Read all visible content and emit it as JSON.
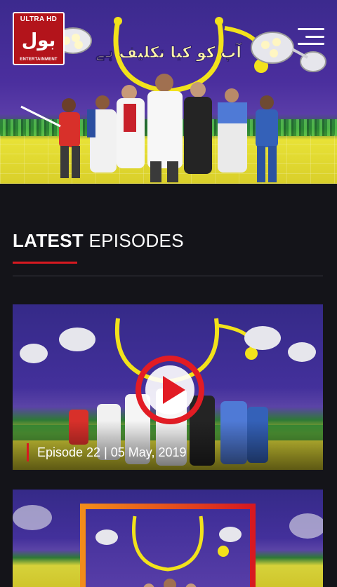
{
  "header": {
    "logo": {
      "top_label": "ULTRA HD",
      "mark": "بول",
      "bottom_label": "ENTERTAINMENT"
    },
    "menu_icon": "hamburger-menu-icon",
    "show_title_art": "آپ کو کیا تکلیف ہے"
  },
  "section": {
    "title_bold": "LATEST",
    "title_light": " EPISODES"
  },
  "episodes": [
    {
      "caption": "Episode 22 | 05 May, 2019",
      "play_icon": "play-icon"
    }
  ],
  "colors": {
    "accent": "#d71920",
    "background": "#141419",
    "frame_orange": "#f28c1a"
  }
}
